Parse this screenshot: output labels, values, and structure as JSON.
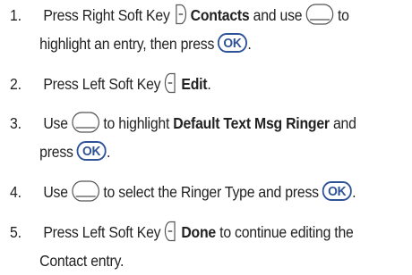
{
  "steps": [
    {
      "number": "1.",
      "t1": "Press Right Soft Key",
      "bold1": "Contacts",
      "t2": "and use",
      "t3": "to",
      "line2": "highlight an entry, then press",
      "end": "."
    },
    {
      "number": "2.",
      "t1": "Press Left Soft Key",
      "bold1": "Edit",
      "end": "."
    },
    {
      "number": "3.",
      "t1": "Use",
      "t2": "to highlight",
      "bold1": "Default Text Msg Ringer",
      "t3": "and",
      "line2": "press",
      "end": "."
    },
    {
      "number": "4.",
      "t1": "Use",
      "t2": "to select the Ringer Type and press",
      "end": "."
    },
    {
      "number": "5.",
      "t1": "Press Left Soft Key",
      "bold1": "Done",
      "t2": "to continue editing the",
      "line2": "Contact entry."
    }
  ],
  "icons": {
    "ok_label": "OK",
    "ok_color": "#2d5296",
    "key_outline": "#555555"
  }
}
